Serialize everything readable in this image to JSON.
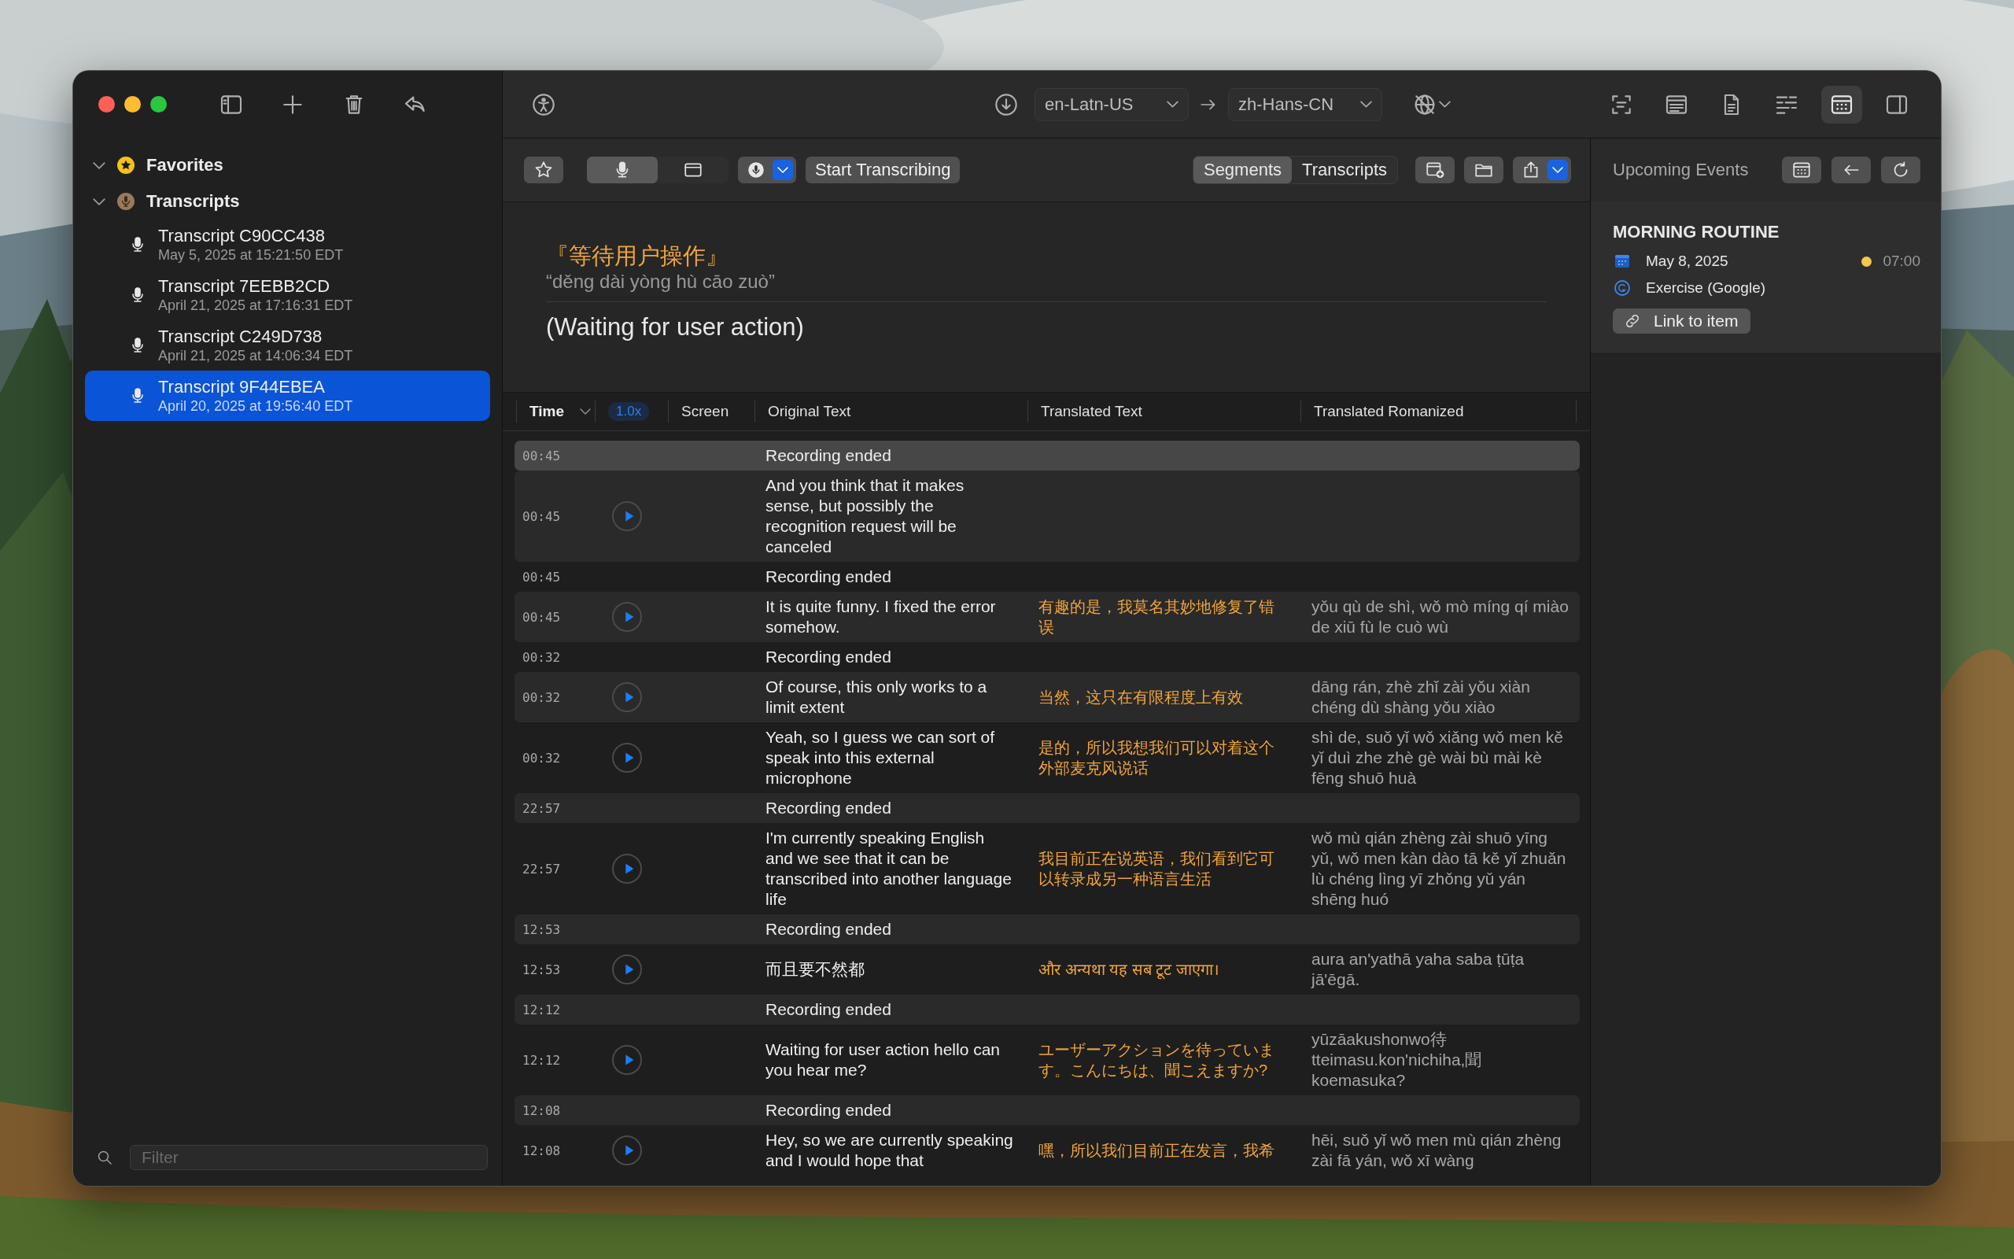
{
  "sidebar": {
    "sections": [
      {
        "kind": "favorites",
        "label": "Favorites",
        "expanded": true
      },
      {
        "kind": "transcripts",
        "label": "Transcripts",
        "expanded": true,
        "children": [
          {
            "title": "Transcript C90CC438",
            "date": "May 5, 2025 at 15:21:50 EDT",
            "selected": false
          },
          {
            "title": "Transcript 7EEBB2CD",
            "date": "April 21, 2025 at 17:16:31 EDT",
            "selected": false
          },
          {
            "title": "Transcript C249D738",
            "date": "April 21, 2025 at 14:06:34 EDT",
            "selected": false
          },
          {
            "title": "Transcript 9F44EBEA",
            "date": "April 20, 2025 at 19:56:40 EDT",
            "selected": true
          }
        ]
      }
    ],
    "filter": {
      "placeholder": "Filter"
    }
  },
  "toolbar": {
    "source_language": "en-Latn-US",
    "target_language": "zh-Hans-CN",
    "view_buttons": [
      {
        "kind": "scan",
        "selected": false
      },
      {
        "kind": "text",
        "selected": false
      },
      {
        "kind": "document",
        "selected": false
      },
      {
        "kind": "list",
        "selected": false
      },
      {
        "kind": "calendar",
        "selected": true
      },
      {
        "kind": "sidebar",
        "selected": false
      }
    ]
  },
  "controls": {
    "sources": [
      {
        "kind": "microphone",
        "selected": true
      },
      {
        "kind": "screen",
        "selected": false
      }
    ],
    "start_button": "Start Transcribing",
    "view_tabs": [
      {
        "label": "Segments",
        "selected": true
      },
      {
        "label": "Transcripts",
        "selected": false
      }
    ]
  },
  "preview": {
    "translated": "『等待用户操作』",
    "romanized": "“děng dài yòng hù cāo zuò”",
    "original": "(Waiting for user action)"
  },
  "table": {
    "columns": [
      {
        "label": "Time",
        "kind": "sort"
      },
      {
        "label": "1.0x",
        "kind": "speed"
      },
      {
        "label": "Screen",
        "kind": "plain"
      },
      {
        "label": "Original Text",
        "kind": "plain"
      },
      {
        "label": "Translated Text",
        "kind": "plain"
      },
      {
        "label": "Translated Romanized",
        "kind": "plain"
      }
    ],
    "rows": [
      {
        "kind": "event",
        "time": "00:45",
        "text": "Recording ended",
        "selected": true
      },
      {
        "kind": "segment",
        "time": "00:45",
        "original": "And you think that it makes sense, but possibly the recognition request will be canceled",
        "selected": false
      },
      {
        "kind": "event",
        "time": "00:45",
        "text": "Recording ended",
        "selected": false
      },
      {
        "kind": "segment",
        "time": "00:45",
        "original": "It is quite funny. I fixed the error somehow.",
        "translated": "有趣的是，我莫名其妙地修复了错误",
        "romanized": "yǒu qù de shì, wǒ mò míng qí miào de xiū fù le cuò wù",
        "selected": false
      },
      {
        "kind": "event",
        "time": "00:32",
        "text": "Recording ended",
        "selected": false
      },
      {
        "kind": "segment",
        "time": "00:32",
        "original": "Of course, this only works to a limit extent",
        "translated": "当然，这只在有限程度上有效",
        "romanized": "dāng rán, zhè zhǐ zài yǒu xiàn chéng dù shàng yǒu xiào",
        "selected": false
      },
      {
        "kind": "segment",
        "time": "00:32",
        "original": "Yeah, so I guess we can sort of speak into this external microphone",
        "translated": "是的，所以我想我们可以对着这个外部麦克风说话",
        "romanized": "shì de, suǒ yǐ wǒ xiǎng wǒ men kě yǐ duì zhe zhè gè wài bù mài kè fēng shuō huà",
        "selected": false
      },
      {
        "kind": "event",
        "time": "22:57",
        "text": "Recording ended",
        "selected": false
      },
      {
        "kind": "segment",
        "time": "22:57",
        "original": "I'm currently speaking English and we see that it can be transcribed into another language life",
        "translated": "我目前正在说英语，我们看到它可以转录成另一种语言生活",
        "romanized": "wǒ mù qián zhèng zài shuō yīng yǔ, wǒ men kàn dào tā kě yǐ zhuǎn lù chéng lìng yī zhǒng yǔ yán shēng huó",
        "selected": false
      },
      {
        "kind": "event",
        "time": "12:53",
        "text": "Recording ended",
        "selected": false
      },
      {
        "kind": "segment",
        "time": "12:53",
        "original": "而且要不然都",
        "translated": "और अन्यथा यह सब टूट जाएगा।",
        "romanized": "aura an'yathā yaha saba ṭūṭa jā'ēgā.",
        "selected": false
      },
      {
        "kind": "event",
        "time": "12:12",
        "text": "Recording ended",
        "selected": false
      },
      {
        "kind": "segment",
        "time": "12:12",
        "original": "Waiting for user action hello can you hear me?",
        "translated": "ユーザーアクションを待っています。こんにちは、聞こえますか?",
        "romanized": "yūzāakushonwo待 tteimasu.kon'nichiha,聞 koemasuka?",
        "selected": false
      },
      {
        "kind": "event",
        "time": "12:08",
        "text": "Recording ended",
        "selected": false
      },
      {
        "kind": "segment",
        "time": "12:08",
        "original": "Hey, so we are currently speaking and I would hope that",
        "translated": "嘿，所以我们目前正在发言，我希",
        "romanized": "hēi, suǒ yǐ wǒ men mù qián zhèng zài fā yán, wǒ xī wàng",
        "selected": false
      }
    ]
  },
  "upcoming": {
    "title": "Upcoming Events",
    "event": {
      "title": "MORNING ROUTINE",
      "date": "May 8, 2025",
      "time": "07:00",
      "color": "#f5c84c",
      "calendar": "Exercise (Google)"
    },
    "link_button": "Link to item"
  }
}
